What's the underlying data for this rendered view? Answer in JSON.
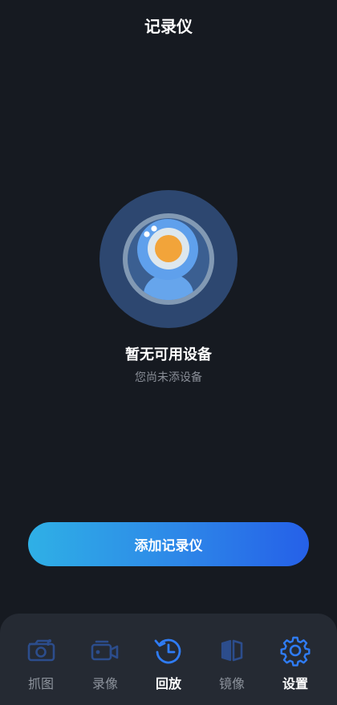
{
  "header": {
    "title": "记录仪"
  },
  "empty_state": {
    "illustration_icon": "webcam-icon",
    "title": "暂无可用设备",
    "subtitle": "您尚未添设备"
  },
  "actions": {
    "add_button_label": "添加记录仪"
  },
  "tabbar": {
    "items": [
      {
        "label": "抓图",
        "icon": "camera-icon",
        "active": false
      },
      {
        "label": "录像",
        "icon": "video-camera-icon",
        "active": false
      },
      {
        "label": "回放",
        "icon": "playback-icon",
        "active": true
      },
      {
        "label": "镜像",
        "icon": "mirror-icon",
        "active": false
      },
      {
        "label": "设置",
        "icon": "gear-icon",
        "active": true
      }
    ]
  },
  "colors": {
    "background": "#161a21",
    "accent_blue": "#2f7cf6",
    "inactive_icon": "#2c4d8c",
    "tabbar_background": "#252a33",
    "button_gradient_start": "#2fb0e6",
    "button_gradient_end": "#2560e8"
  }
}
